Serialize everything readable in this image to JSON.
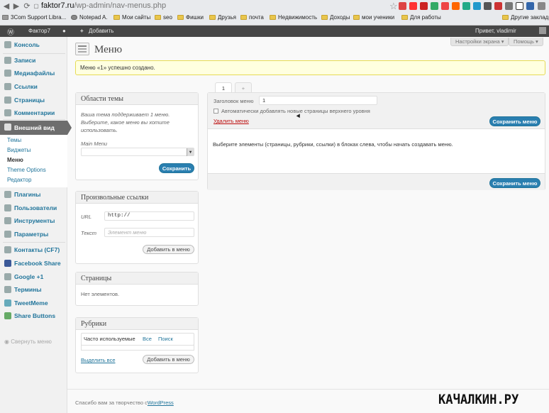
{
  "browser": {
    "url_host": "faktor7.ru",
    "url_path": "/wp-admin/nav-menus.php",
    "bookmarks": [
      "3Com Support Libra...",
      "Notepad A.",
      "Мои сайты",
      "seo",
      "Фишки",
      "Друзья",
      "почта",
      "Недвижимость",
      "Доходы",
      "мои ученики",
      "Для работы"
    ],
    "other_bookmarks": "Другие закладки"
  },
  "adminbar": {
    "site": "Фактор7",
    "add": "Добавить",
    "greeting": "Привет, vladimir"
  },
  "sidebar": {
    "items": [
      {
        "label": "Консоль",
        "icon": "dashboard-icon"
      },
      {
        "label": "Записи",
        "icon": "posts-icon"
      },
      {
        "label": "Медиафайлы",
        "icon": "media-icon"
      },
      {
        "label": "Ссылки",
        "icon": "links-icon"
      },
      {
        "label": "Страницы",
        "icon": "pages-icon"
      },
      {
        "label": "Комментарии",
        "icon": "comments-icon"
      },
      {
        "label": "Внешний вид",
        "icon": "appearance-icon"
      },
      {
        "label": "Плагины",
        "icon": "plugins-icon"
      },
      {
        "label": "Пользователи",
        "icon": "users-icon"
      },
      {
        "label": "Инструменты",
        "icon": "tools-icon"
      },
      {
        "label": "Параметры",
        "icon": "settings-icon"
      },
      {
        "label": "Контакты (CF7)",
        "icon": "contacts-icon"
      },
      {
        "label": "Facebook Share",
        "icon": "facebook-icon"
      },
      {
        "label": "Google +1",
        "icon": "google-icon"
      },
      {
        "label": "Термины",
        "icon": "terms-icon"
      },
      {
        "label": "TweetMeme",
        "icon": "tweetmeme-icon"
      },
      {
        "label": "Share Buttons",
        "icon": "share-icon"
      }
    ],
    "submenu": [
      "Темы",
      "Виджеты",
      "Меню",
      "Theme Options",
      "Редактор"
    ],
    "collapse": "Свернуть меню"
  },
  "screen_options": "Настройки экрана",
  "help": "Помощь",
  "page_title": "Меню",
  "notice": "Меню «1» успешно создано.",
  "tabs": {
    "current": "1",
    "add": "+"
  },
  "theme_locations": {
    "title": "Области темы",
    "description": "Ваша тема поддерживает 1 меню. Выберите, какое меню вы хотите использовать.",
    "main_menu_label": "Main Menu",
    "save": "Сохранить"
  },
  "custom_links": {
    "title": "Произвольные ссылки",
    "url_label": "URL",
    "url_value": "http://",
    "text_label": "Текст",
    "text_placeholder": "Элемент меню",
    "add": "Добавить в меню"
  },
  "pages_box": {
    "title": "Страницы",
    "empty": "Нет элементов."
  },
  "categories_box": {
    "title": "Рубрики",
    "tab_popular": "Часто используемые",
    "tab_all": "Все",
    "tab_search": "Поиск",
    "select_all": "Выделить все",
    "add": "Добавить в меню"
  },
  "editor": {
    "name_label": "Заголовок меню",
    "name_value": "1",
    "auto_add": "Автоматически добавлять новые страницы верхнего уровня",
    "delete": "Удалить меню",
    "save": "Сохранить меню",
    "instructions": "Выберите элементы (страницы, рубрики, ссылки) в блоках слева, чтобы начать создавать меню."
  },
  "footer": {
    "text": "Спасибо вам за творчество с",
    "wp": "WordPress"
  },
  "watermark": "КАЧАЛКИН.РУ",
  "colors": {
    "accent": "#21759b",
    "notice_bg": "#ffffe0",
    "adminbar": "#464646"
  }
}
